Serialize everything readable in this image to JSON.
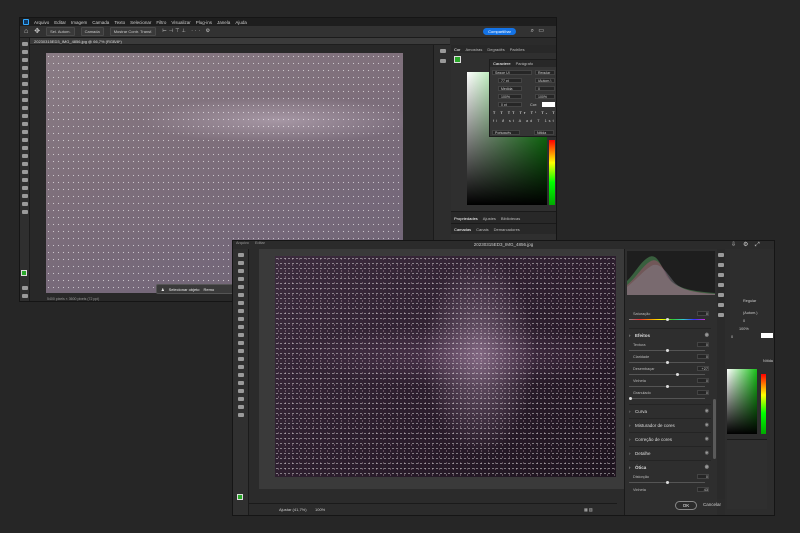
{
  "window1": {
    "menu": [
      "Arquivo",
      "Editar",
      "Imagem",
      "Camada",
      "Texto",
      "Selecionar",
      "Filtro",
      "Visualizar",
      "Plug-ins",
      "Janela",
      "Ajuda"
    ],
    "options": {
      "sel_button": "Sel. Autom.",
      "layer_dropdown": "Camada",
      "transform_label": "Mostrar Contr. Transf.",
      "share": "Compartilhar"
    },
    "doc_tab": "20230315ED3_IMG_4856.jpg @ 66,7% (RGB/8*)",
    "status": "5400 pixels × 3600 pixels (72 ppi)",
    "context": {
      "select_subject": "Selecionar objeto",
      "remove": "Remo"
    },
    "color_tabs": [
      "Cor",
      "Amostras",
      "Degradês",
      "Padrões"
    ],
    "character_tabs": [
      "Caractere",
      "Parágrafo"
    ],
    "character": {
      "font": "Segoe UI",
      "style": "Regular",
      "size": "77 pt",
      "leading": "(Autom.)",
      "kerning": "Medida",
      "tracking": "0",
      "vscale": "100%",
      "hscale": "100%",
      "baseline": "0 pt",
      "color_label": "Cor:",
      "language": "Português",
      "aa": "Nítida"
    },
    "props_tabs": [
      "Propriedades",
      "Ajustes",
      "Bibliotecas"
    ],
    "layers_tabs": [
      "Camadas",
      "Canais",
      "Demarcadores"
    ]
  },
  "window2": {
    "menu": [
      "Arquivo",
      "Editar"
    ],
    "title": "20230315ED3_IMG_4856.jpg",
    "zoom": "Ajustar (41,7%)",
    "zoom2": "100%",
    "saturation_label": "Saturação",
    "saturation_value": "0",
    "effects": {
      "title": "Efeitos",
      "sliders": [
        {
          "label": "Textura",
          "value": "0"
        },
        {
          "label": "Claridade",
          "value": "0"
        },
        {
          "label": "Desembaçar",
          "value": "+27"
        },
        {
          "label": "Vinheta",
          "value": "0"
        },
        {
          "label": "Granulado",
          "value": "0"
        }
      ]
    },
    "sections": [
      "Curva",
      "Misturador de cores",
      "Correção de cores",
      "Detalhe"
    ],
    "optics": {
      "title": "Ótica",
      "distortion_label": "Distorção",
      "distortion_value": "0",
      "vignette_label": "Vinheta",
      "vignette_value": "43"
    },
    "ok": "OK",
    "cancel": "Cancelar",
    "right_mini": [
      "Regular",
      "(Autom.)",
      "0",
      "100%",
      "0",
      "Nítida"
    ]
  },
  "colors": {
    "accent": "#1473e6",
    "swatch_fg": "#2aa82a",
    "swatch_bg": "#ffffff"
  }
}
